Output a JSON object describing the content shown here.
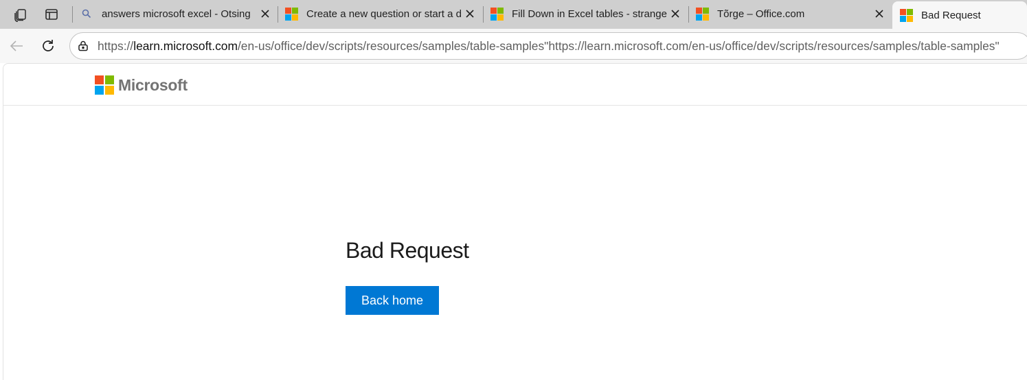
{
  "browser": {
    "tabs": [
      {
        "title": "answers microsoft excel - Otsing",
        "icon": "search-icon",
        "active": false
      },
      {
        "title": "Create a new question or start a d",
        "icon": "microsoft-logo-icon",
        "active": false
      },
      {
        "title": "Fill Down in Excel tables - strange",
        "icon": "microsoft-logo-icon",
        "active": false
      },
      {
        "title": "Tõrge – Office.com",
        "icon": "microsoft-logo-icon",
        "active": false
      },
      {
        "title": "Bad Request",
        "icon": "microsoft-logo-icon",
        "active": true
      }
    ],
    "address_bar": {
      "url_scheme": "https://",
      "url_host": "learn.microsoft.com",
      "url_path": "/en-us/office/dev/scripts/resources/samples/table-samples\"https://learn.microsoft.com/en-us/office/dev/scripts/resources/samples/table-samples\""
    }
  },
  "page": {
    "brand": "Microsoft",
    "title": "Bad Request",
    "back_button_label": "Back home"
  },
  "colors": {
    "ms_red": "#f25022",
    "ms_green": "#7fba00",
    "ms_blue": "#00a4ef",
    "ms_yellow": "#ffb900",
    "button_blue": "#0078d4"
  }
}
